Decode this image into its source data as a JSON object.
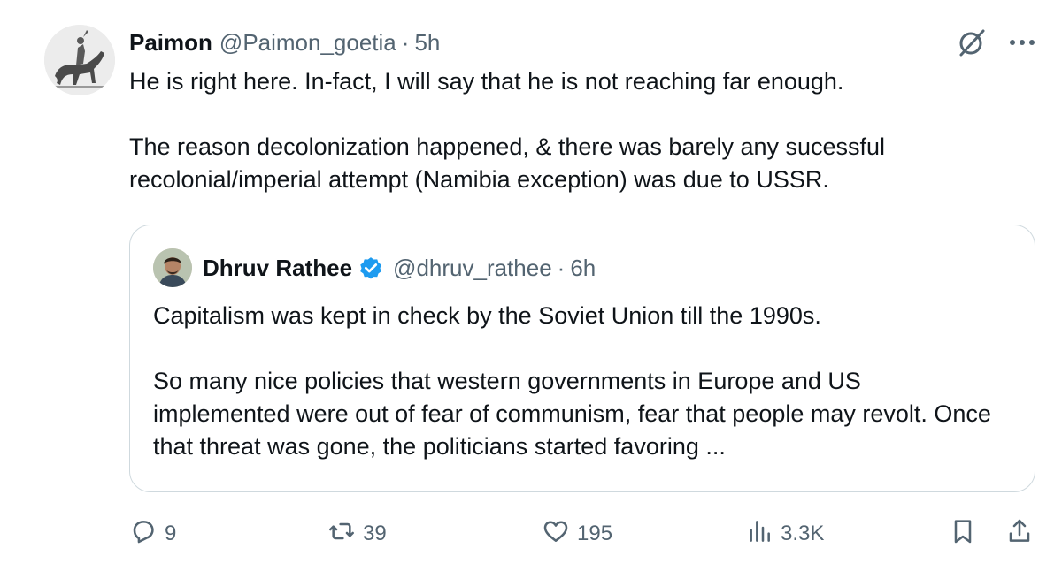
{
  "tweet": {
    "author": {
      "display_name": "Paimon",
      "handle": "@Paimon_goetia",
      "time": "5h"
    },
    "separator": "·",
    "paragraphs": [
      "He is right here. In-fact, I will say that he is not reaching far enough.",
      "The reason decolonization happened, & there was barely any sucessful recolonial/imperial attempt (Namibia exception) was due to USSR."
    ],
    "quote": {
      "author": {
        "display_name": "Dhruv Rathee",
        "handle": "@dhruv_rathee",
        "time": "6h",
        "verified": true
      },
      "paragraphs": [
        "Capitalism was kept in check by the Soviet Union till the 1990s.",
        "So many nice policies that western governments in Europe and US implemented were out of fear of communism, fear that people may revolt. Once that threat was gone, the politicians started favoring ..."
      ]
    },
    "actions": {
      "replies": "9",
      "reposts": "39",
      "likes": "195",
      "views": "3.3K"
    }
  },
  "colors": {
    "text_primary": "#0f1419",
    "text_secondary": "#536471",
    "border": "#cfd9de",
    "verified": "#1d9bf0"
  },
  "icons": [
    "grok-icon",
    "more-icon",
    "verified-icon",
    "reply-icon",
    "repost-icon",
    "like-icon",
    "views-icon",
    "bookmark-icon",
    "share-icon"
  ]
}
